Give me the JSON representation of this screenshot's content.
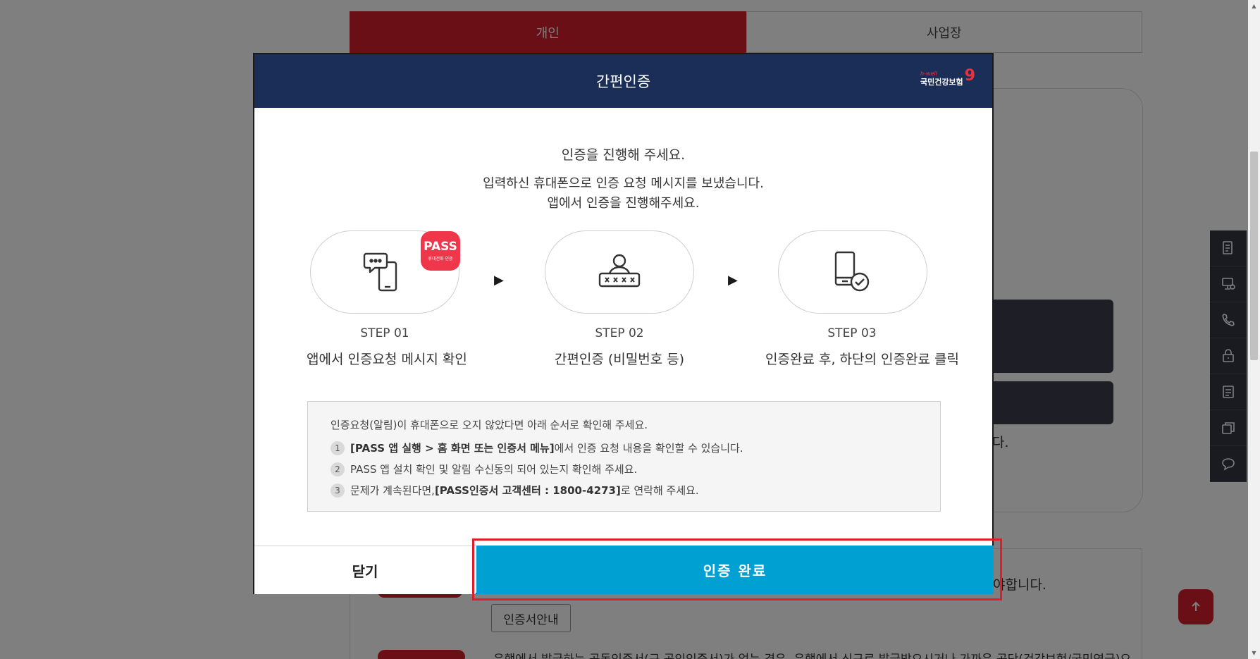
{
  "background": {
    "tabs": [
      {
        "label": "개인",
        "active": true
      },
      {
        "label": "사업장",
        "active": false
      }
    ],
    "partial_text_da": "다.",
    "partial_text_right": "야합니다.",
    "cert_guide_button": "인증서안내",
    "bottom_text": "은행에서 발급하는 공동인증서(구 공인인증서)가 없는 경우, 은행에서 신규로 발급받으시거나 가까운 공단(건강보험/국민연금)으"
  },
  "side_toolbar": {
    "items": [
      "document-icon",
      "monitor-icon",
      "phone-icon",
      "lock-icon",
      "list-icon",
      "copy-icon",
      "chat-icon"
    ]
  },
  "scroll_top_icon": "arrow-up-icon",
  "modal": {
    "title": "간편인증",
    "logo": {
      "small": "h-well",
      "main": "국민건강보험"
    },
    "intro_line1": "인증을 진행해 주세요.",
    "intro_line2": "입력하신 휴대폰으로 인증 요청 메시지를 보냈습니다.",
    "intro_line3": "앱에서 인증을 진행해주세요.",
    "pass_badge": {
      "main": "PASS",
      "sub": "휴대전화 인증"
    },
    "steps": [
      {
        "label": "STEP 01",
        "desc": "앱에서 인증요청 메시지 확인",
        "icon": "phone-message-icon"
      },
      {
        "label": "STEP 02",
        "desc": "간편인증 (비밀번호 등)",
        "icon": "user-password-icon"
      },
      {
        "label": "STEP 03",
        "desc": "인증완료 후, 하단의 인증완료 클릭",
        "icon": "phone-check-icon"
      }
    ],
    "notice": {
      "title": "인증요청(알림)이 휴대폰으로 오지 않았다면 아래 순서로 확인해 주세요.",
      "items": [
        {
          "num": "1",
          "bold": "[PASS 앱 실행 > 홈 화면 또는 인증서 메뉴]",
          "text": " 에서 인증 요청 내용을 확인할 수 있습니다.",
          "bold_after": "",
          "text_after": ""
        },
        {
          "num": "2",
          "bold": "",
          "text": "PASS 앱 설치 확인 및 알림 수신동의 되어 있는지 확인해 주세요.",
          "bold_after": "",
          "text_after": ""
        },
        {
          "num": "3",
          "bold": "",
          "text": "문제가 계속된다면, ",
          "bold_after": "[PASS인증서 고객센터 : 1800-4273]",
          "text_after": " 로 연락해 주세요."
        }
      ]
    },
    "close_label": "닫기",
    "confirm_label": "인증 완료"
  },
  "colors": {
    "header_navy": "#1b2e57",
    "confirm_blue": "#00a0d2",
    "brand_red": "#d51f2a",
    "highlight_red": "#e01e2a"
  }
}
